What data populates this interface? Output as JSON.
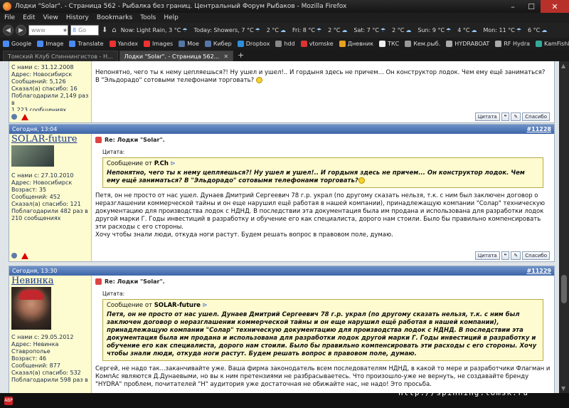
{
  "window": {
    "title": "Лодки \"Solar\". - Страница 562 - Рыбалка без границ. Центральный Форум Рыбаков - Mozilla Firefox",
    "min": "–",
    "max": "☐",
    "close": "✕"
  },
  "menu": [
    "File",
    "Edit",
    "View",
    "History",
    "Bookmarks",
    "Tools",
    "Help"
  ],
  "nav": {
    "url_placeholder": "www",
    "search_placeholder": "Go",
    "weather": [
      {
        "label": "Now: Light Rain, 3 °C",
        "icon": "☂"
      },
      {
        "label": "Today: Showers, 7 °C",
        "icon": "☂"
      },
      {
        "label": "2 °C",
        "icon": "☁"
      },
      {
        "label": "Fri: 8 °C",
        "icon": "☂"
      },
      {
        "label": "2 °C",
        "icon": "☁"
      },
      {
        "label": "Sat: 7 °C",
        "icon": "☂"
      },
      {
        "label": "2 °C",
        "icon": "☁"
      },
      {
        "label": "Sun: 9 °C",
        "icon": "☂"
      },
      {
        "label": "4 °C",
        "icon": "☁"
      },
      {
        "label": "Mon: 11 °C",
        "icon": "☂"
      },
      {
        "label": "6 °C",
        "icon": "☁"
      }
    ]
  },
  "bookmarks": [
    {
      "label": "Google",
      "color": "#4a8af4"
    },
    {
      "label": "Image",
      "color": "#4a8af4"
    },
    {
      "label": "Translate",
      "color": "#4a8af4"
    },
    {
      "label": "Yandex",
      "color": "#e33"
    },
    {
      "label": "Images",
      "color": "#e33"
    },
    {
      "label": "Мое",
      "color": "#5576a8"
    },
    {
      "label": "Кибер",
      "color": "#5576a8"
    },
    {
      "label": "Dropbox",
      "color": "#2f8fdd"
    },
    {
      "label": "hdd",
      "color": "#888"
    },
    {
      "label": "vtomske",
      "color": "#d33"
    },
    {
      "label": "Дневник",
      "color": "#e8a020"
    },
    {
      "label": "ТКС",
      "color": "#eee"
    },
    {
      "label": "Кем.рыб.",
      "color": "#999"
    },
    {
      "label": "HYDRABOAT",
      "color": "#aaa"
    },
    {
      "label": "RF Hydra",
      "color": "#aaa"
    },
    {
      "label": "KamFishing",
      "color": "#3a9"
    },
    {
      "label": "Прием",
      "color": "#9c3"
    }
  ],
  "tabs": [
    {
      "label": "Томский Клуб Спиннингистов - Н...",
      "active": false
    },
    {
      "label": "Лодки \"Solar\". - Страница 562...",
      "active": true
    }
  ],
  "posts": [
    {
      "partial": true,
      "side": [
        "С нами с: 31.12.2008",
        "Адрес: Новосибирск",
        "Сообщений: 5,126",
        "Сказал(а) спасибо: 16",
        "Поблагодарили 2,149 раз в",
        "1,223 сообщениях"
      ],
      "text": "Непонятно, чего ты к нему цепляешься?! Ну ушел и ушел!.. И гордыня здесь не причем... Он конструктор лодок. Чем ему ещё заниматься? В \"Эльдорадо\" сотовыми телефонами торговать?"
    },
    {
      "date": "Сегодня, 13:04",
      "num": "#11228",
      "user": "SOLAR-future",
      "side": [
        "С нами с: 27.10.2010",
        "Адрес: Новосибирск",
        "Возраст: 35",
        "Сообщений: 452",
        "Сказал(а) спасибо: 121",
        "Поблагодарили 482 раз в",
        "210 сообщениях"
      ],
      "title": "Re: Лодки \"Solar\".",
      "quote_label": "Цитата:",
      "quote_from_prefix": "Сообщение от",
      "quote_from": "P.Ch",
      "quote_text": "Непонятно, чего ты к нему цепляешься?! Ну ушел и ушел!.. И гордыня здесь не причем... Он конструктор лодок. Чем ему ещё заниматься? В \"Эльдорадо\" сотовыми телефонами торговать?",
      "text": "Петя, он не просто от нас ушел. Дунаев Дмитрий Сергеевич 78 г.р. украл (по другому сказать нельзя, т.к. с ним был заключен договор о неразглашении коммерческой тайны и он еще нарушил ещё работая в нашей компании), принадлежащую компании \"Солар\" техническую документацию для производства лодок с НДНД. В последствии эта документация была им продана и использована для разработки лодок другой марки Г. Годы инвестиций в разработку и обучение его как специалиста, дорого нам стоили. Было бы правильно компенсировать эти расходы с его стороны.",
      "text2": "Хочу чтобы знали люди, откуда ноги растут. Будем решать вопрос в правовом поле, думаю."
    },
    {
      "date": "Сегодня, 13:30",
      "num": "#11229",
      "user": "Невинка",
      "side": [
        "С нами с: 29.05.2012",
        "Адрес: Невинка",
        "Ставрополье",
        "Возраст: 46",
        "Сообщений: 877",
        "Сказал(а) спасибо: 532",
        "Поблагодарили 598 раз в"
      ],
      "title": "Re: Лодки \"Solar\".",
      "quote_label": "Цитата:",
      "quote_from_prefix": "Сообщение от",
      "quote_from": "SOLAR-future",
      "quote_text": "Петя, он не просто от нас ушел. Дунаев Дмитрий Сергеевич 78 г.р. украл (по другому сказать нельзя, т.к. с ним был заключен договор о неразглашении коммерческой тайны и он еще нарушил ещё работая в нашей компании), принадлежащую компании \"Солар\" техническую документацию для производства лодок с НДНД. В последствии эта документация была им продана и использована для разработки лодок другой марки Г. Годы инвестиций в разработку и обучение его как специалиста, дорого нам стоили. Было бы правильно компенсировать эти расходы с его стороны. Хочу чтобы знали люди, откуда ноги растут. Будем решать вопрос в правовом поле, думаю.",
      "text": "Сергей, не надо так...заканчивайте уже. Ваша фирма законодатель всем последователям НДНД, в какой то мере и разработчики Флагман и КомпАс являются Д.Дунаевыми, но вы к ним претензиями не разбрасываетесь. Что произошло-уже не вернуть, не создавайте бренду \"HYDRA\" проблем, почитателей \"Н\" аудитория уже достаточная не обижайте нас, не надо! Это просьба."
    }
  ],
  "footer_buttons": {
    "quote": "Цитата",
    "thanks": "Спасибо"
  },
  "overlay_url": "http://spinning.tomsk.ru"
}
